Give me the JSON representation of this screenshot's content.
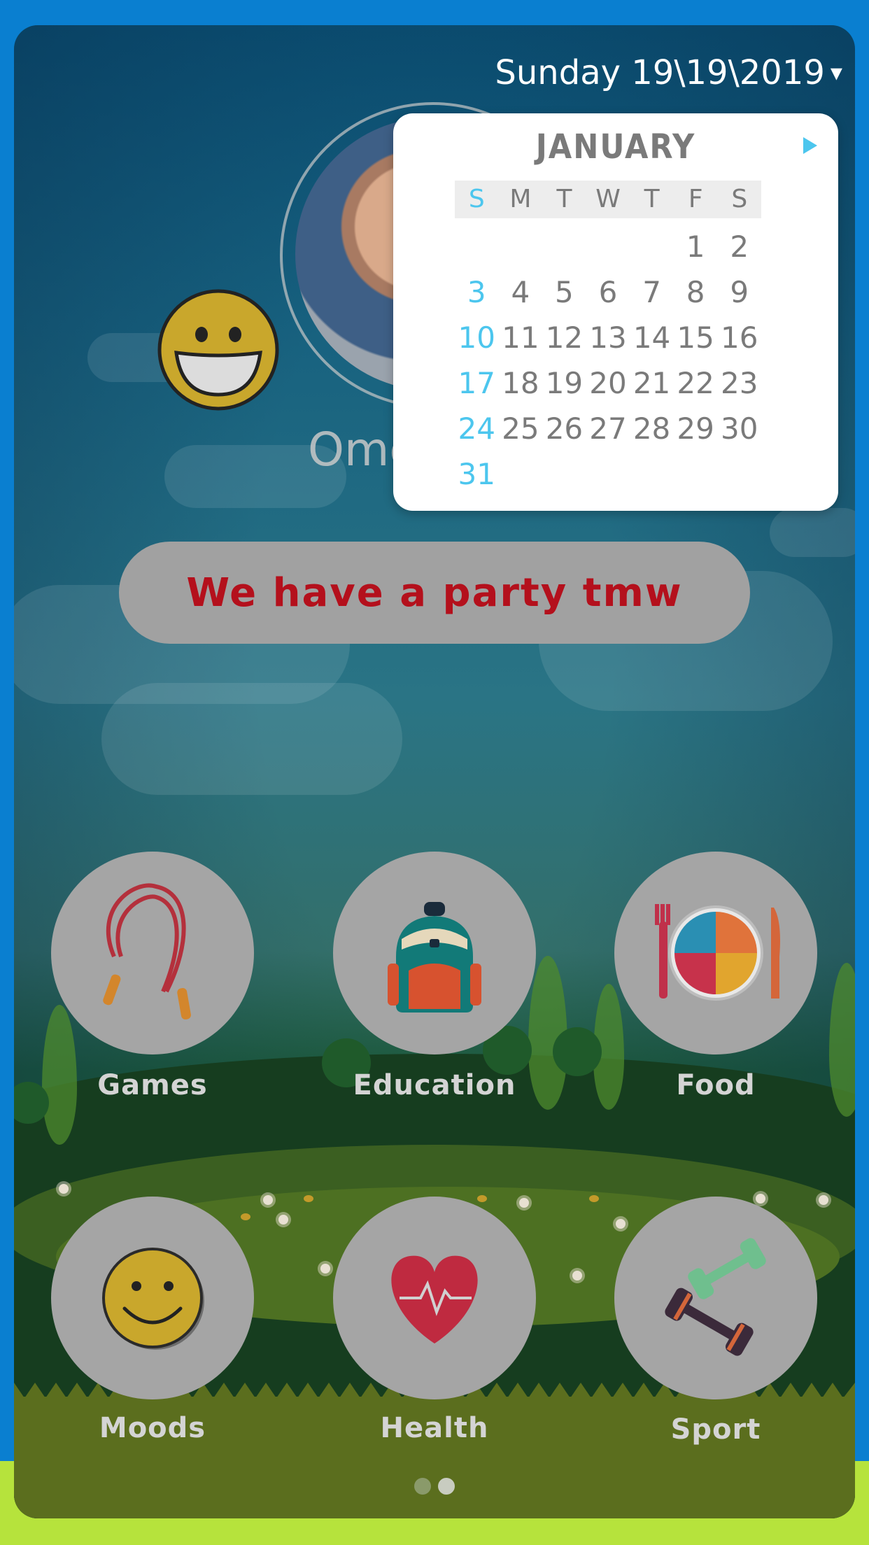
{
  "header": {
    "date_text": "Sunday 19\\19\\2019",
    "caret_glyph": "▾"
  },
  "profile": {
    "name_partial": "Omc",
    "mood_icon": "grinning-smiley-icon"
  },
  "calendar": {
    "month": "JANUARY",
    "weekdays": [
      "S",
      "M",
      "T",
      "W",
      "T",
      "F",
      "S"
    ],
    "days": [
      [
        "",
        "",
        "",
        "",
        "",
        "1",
        "2"
      ],
      [
        "3",
        "4",
        "5",
        "6",
        "7",
        "8",
        "9"
      ],
      [
        "10",
        "11",
        "12",
        "13",
        "14",
        "15",
        "16"
      ],
      [
        "17",
        "18",
        "19",
        "20",
        "21",
        "22",
        "23"
      ],
      [
        "24",
        "25",
        "26",
        "27",
        "28",
        "29",
        "30"
      ],
      [
        "31",
        "",
        "",
        "",
        "",
        "",
        ""
      ]
    ],
    "accent": "#4cc6ee"
  },
  "message": {
    "text": "We have a party tmw",
    "color": "#b4101c"
  },
  "tiles": [
    {
      "label": "Games",
      "icon": "jump-rope-icon"
    },
    {
      "label": "Education",
      "icon": "backpack-icon"
    },
    {
      "label": "Food",
      "icon": "plate-fork-knife-icon"
    },
    {
      "label": "Moods",
      "icon": "smiley-face-icon"
    },
    {
      "label": "Health",
      "icon": "heart-pulse-icon"
    },
    {
      "label": "Sport",
      "icon": "dumbbells-icon"
    }
  ],
  "pager": {
    "pages": 2,
    "active": 2
  }
}
